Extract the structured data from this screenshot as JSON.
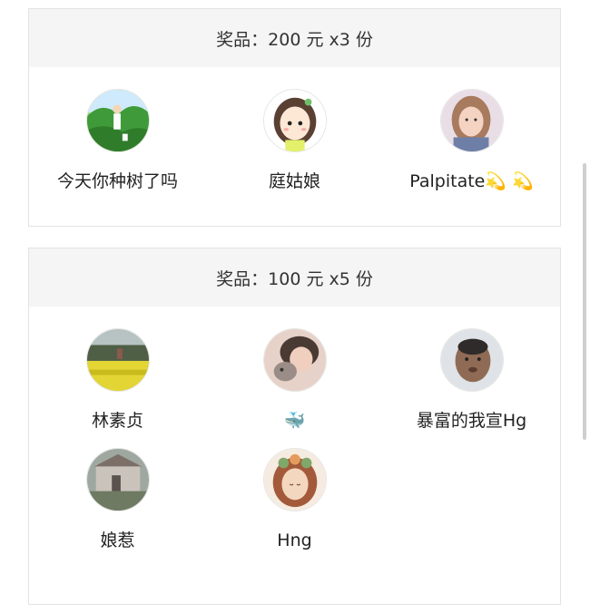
{
  "tiers": [
    {
      "prize_label": "奖品：200 元 x3 份",
      "winners": [
        {
          "name": "今天你种树了吗",
          "avatar": "tree-planting-avatar"
        },
        {
          "name": "庭姑娘",
          "avatar": "cartoon-girl-avatar"
        },
        {
          "name": "Palpitate💫 💫",
          "avatar": "woman-portrait-avatar"
        }
      ]
    },
    {
      "prize_label": "奖品：100 元 x5 份",
      "winners": [
        {
          "name": "林素贞",
          "avatar": "flower-field-avatar"
        },
        {
          "name": "🐳",
          "avatar": "girl-with-cat-avatar"
        },
        {
          "name": "暴富的我宣Hg",
          "avatar": "chubby-kid-avatar"
        },
        {
          "name": "娘惹",
          "avatar": "house-ruins-avatar"
        },
        {
          "name": "Hng",
          "avatar": "floral-girl-illustration-avatar"
        }
      ]
    }
  ]
}
